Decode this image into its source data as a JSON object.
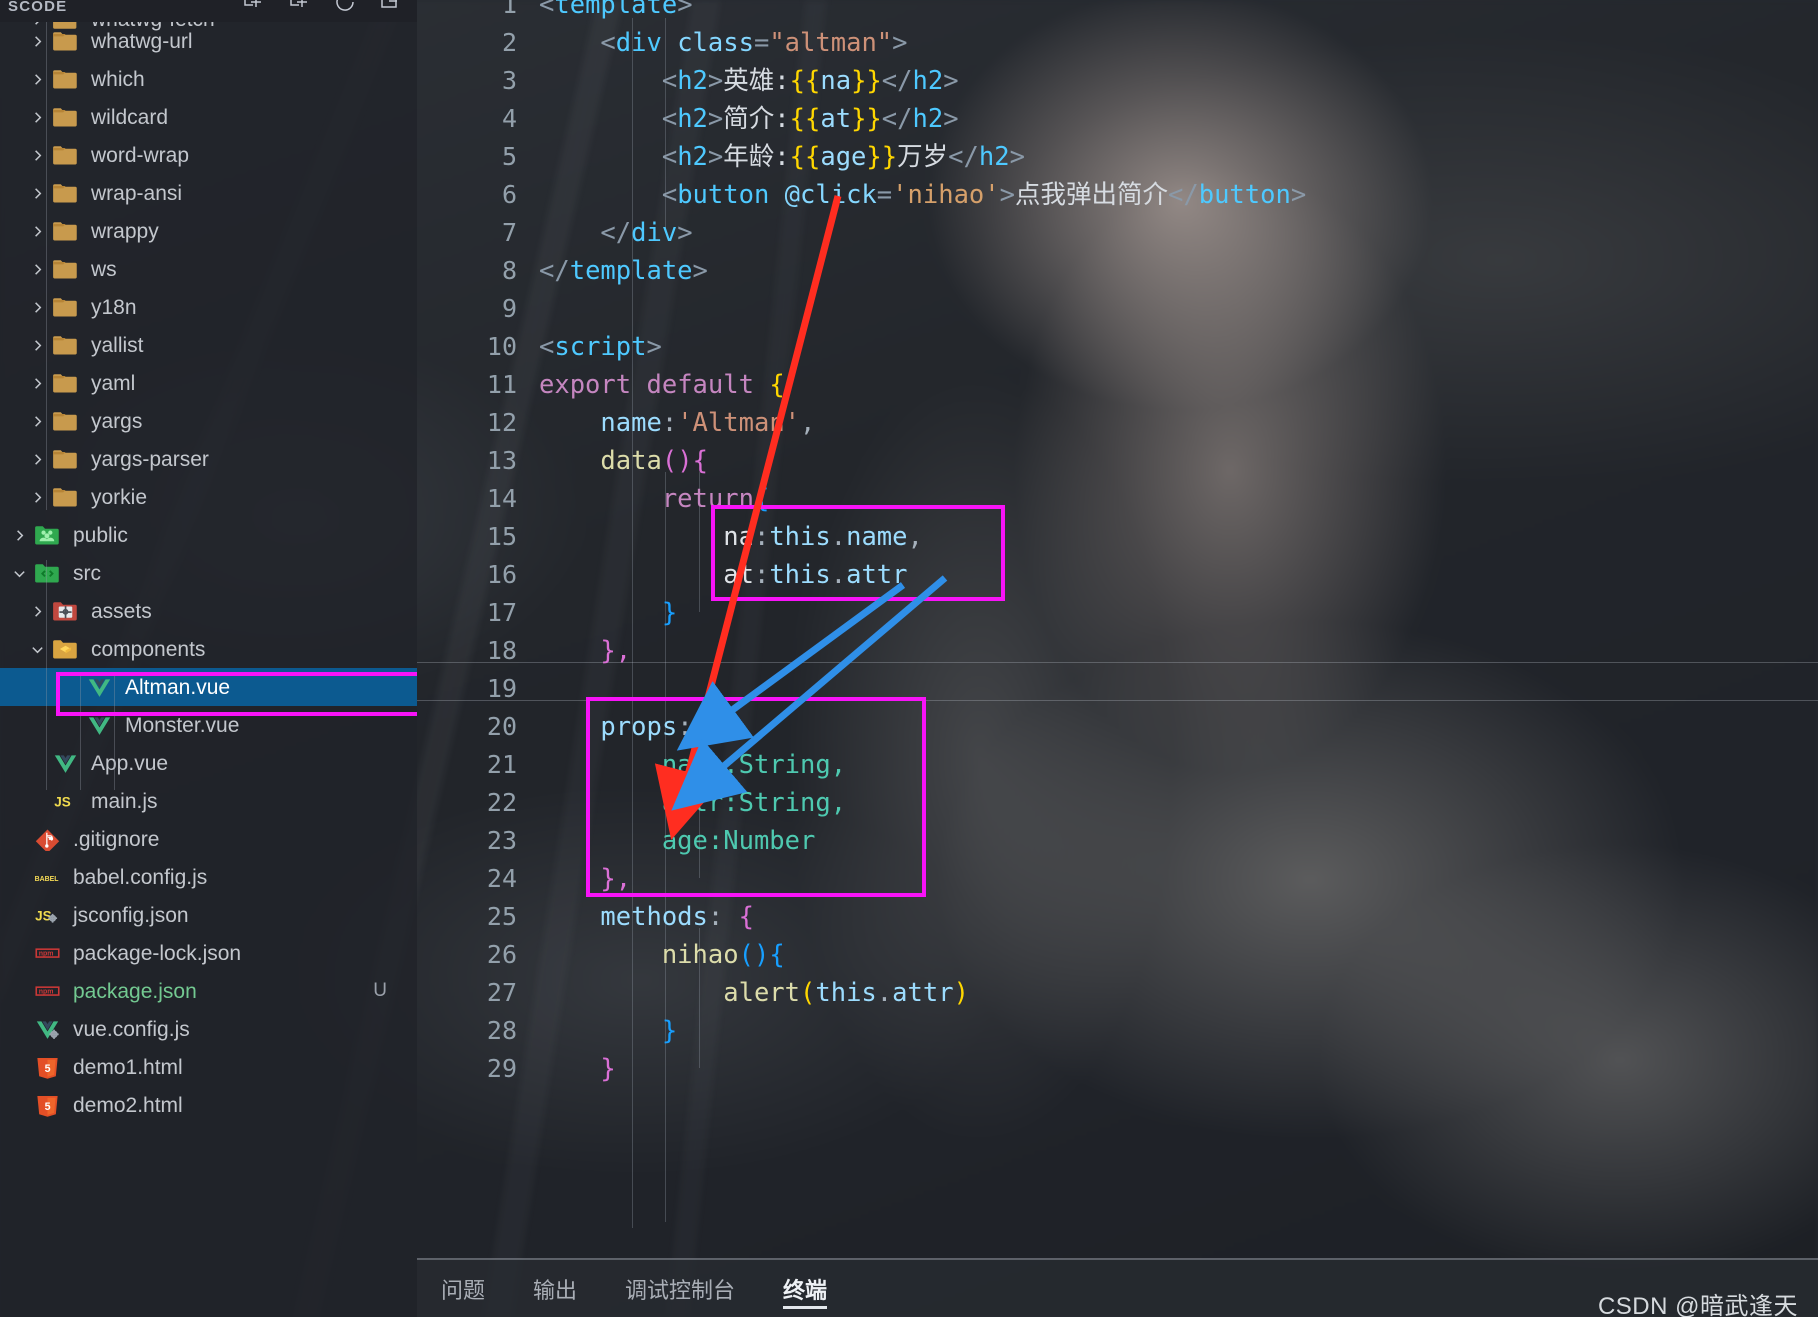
{
  "window": {
    "sidebar_title": "SCODE"
  },
  "sidebar": {
    "actions": [
      {
        "name": "new-file-icon",
        "label": "新建文件"
      },
      {
        "name": "new-folder-icon",
        "label": "新建文件夹"
      },
      {
        "name": "refresh-icon",
        "label": "刷新资源管理器"
      },
      {
        "name": "collapse-all-icon",
        "label": "在资源管理器中折叠文件夹"
      }
    ],
    "clipped_top_item": {
      "label": "whatwg-fetch",
      "icon": "folder-icon"
    },
    "items": [
      {
        "label": "whatwg-url",
        "icon": "folder-icon",
        "indent": 1,
        "expandable": true,
        "expanded": false
      },
      {
        "label": "which",
        "icon": "folder-icon",
        "indent": 1,
        "expandable": true,
        "expanded": false
      },
      {
        "label": "wildcard",
        "icon": "folder-icon",
        "indent": 1,
        "expandable": true,
        "expanded": false
      },
      {
        "label": "word-wrap",
        "icon": "folder-icon",
        "indent": 1,
        "expandable": true,
        "expanded": false
      },
      {
        "label": "wrap-ansi",
        "icon": "folder-icon",
        "indent": 1,
        "expandable": true,
        "expanded": false
      },
      {
        "label": "wrappy",
        "icon": "folder-icon",
        "indent": 1,
        "expandable": true,
        "expanded": false
      },
      {
        "label": "ws",
        "icon": "folder-icon",
        "indent": 1,
        "expandable": true,
        "expanded": false
      },
      {
        "label": "y18n",
        "icon": "folder-icon",
        "indent": 1,
        "expandable": true,
        "expanded": false
      },
      {
        "label": "yallist",
        "icon": "folder-icon",
        "indent": 1,
        "expandable": true,
        "expanded": false
      },
      {
        "label": "yaml",
        "icon": "folder-icon",
        "indent": 1,
        "expandable": true,
        "expanded": false
      },
      {
        "label": "yargs",
        "icon": "folder-icon",
        "indent": 1,
        "expandable": true,
        "expanded": false
      },
      {
        "label": "yargs-parser",
        "icon": "folder-icon",
        "indent": 1,
        "expandable": true,
        "expanded": false
      },
      {
        "label": "yorkie",
        "icon": "folder-icon",
        "indent": 1,
        "expandable": true,
        "expanded": false
      },
      {
        "label": "public",
        "icon": "public-folder-icon",
        "indent": 0,
        "expandable": true,
        "expanded": false
      },
      {
        "label": "src",
        "icon": "src-folder-icon",
        "indent": 0,
        "expandable": true,
        "expanded": true
      },
      {
        "label": "assets",
        "icon": "assets-folder-icon",
        "indent": 1,
        "expandable": true,
        "expanded": false
      },
      {
        "label": "components",
        "icon": "components-folder-icon",
        "indent": 1,
        "expandable": true,
        "expanded": true
      },
      {
        "label": "Altman.vue",
        "icon": "vue-file-icon",
        "indent": 2,
        "expandable": false,
        "selected": true,
        "highlighted": true
      },
      {
        "label": "Monster.vue",
        "icon": "vue-file-icon",
        "indent": 2,
        "expandable": false
      },
      {
        "label": "App.vue",
        "icon": "vue-file-icon",
        "indent": 1,
        "expandable": false
      },
      {
        "label": "main.js",
        "icon": "js-file-icon",
        "indent": 1,
        "expandable": false
      },
      {
        "label": ".gitignore",
        "icon": "git-file-icon",
        "indent": 0,
        "expandable": false
      },
      {
        "label": "babel.config.js",
        "icon": "babel-file-icon",
        "indent": 0,
        "expandable": false
      },
      {
        "label": "jsconfig.json",
        "icon": "jsconfig-file-icon",
        "indent": 0,
        "expandable": false
      },
      {
        "label": "package-lock.json",
        "icon": "npm-file-icon",
        "indent": 0,
        "expandable": false
      },
      {
        "label": "package.json",
        "icon": "npm-file-icon",
        "indent": 0,
        "expandable": false,
        "modified": true,
        "badge": "U"
      },
      {
        "label": "vue.config.js",
        "icon": "vue-config-file-icon",
        "indent": 0,
        "expandable": false
      },
      {
        "label": "demo1.html",
        "icon": "html5-file-icon",
        "indent": -1,
        "expandable": false
      },
      {
        "label": "demo2.html",
        "icon": "html5-file-icon",
        "indent": -1,
        "expandable": false
      }
    ]
  },
  "editor": {
    "language": "vue",
    "first_visible_line": 1,
    "last_visible_line": 29,
    "lines": [
      {
        "n": 1,
        "text": "<template>"
      },
      {
        "n": 2,
        "text": "    <div class=\"altman\">"
      },
      {
        "n": 3,
        "text": "        <h2>英雄:{{na}}</h2>"
      },
      {
        "n": 4,
        "text": "        <h2>简介:{{at}}</h2>"
      },
      {
        "n": 5,
        "text": "        <h2>年龄:{{age}}万岁</h2>"
      },
      {
        "n": 6,
        "text": "        <button @click='nihao'>点我弹出简介</button>"
      },
      {
        "n": 7,
        "text": "    </div>"
      },
      {
        "n": 8,
        "text": "</template>"
      },
      {
        "n": 9,
        "text": ""
      },
      {
        "n": 10,
        "text": "<script>"
      },
      {
        "n": 11,
        "text": "export default {"
      },
      {
        "n": 12,
        "text": "    name:'Altman',"
      },
      {
        "n": 13,
        "text": "    data(){"
      },
      {
        "n": 14,
        "text": "        return{"
      },
      {
        "n": 15,
        "text": "            na:this.name,"
      },
      {
        "n": 16,
        "text": "            at:this.attr"
      },
      {
        "n": 17,
        "text": "        }"
      },
      {
        "n": 18,
        "text": "    },"
      },
      {
        "n": 19,
        "text": ""
      },
      {
        "n": 20,
        "text": "    props:{"
      },
      {
        "n": 21,
        "text": "        name:String,"
      },
      {
        "n": 22,
        "text": "        attr:String,"
      },
      {
        "n": 23,
        "text": "        age:Number"
      },
      {
        "n": 24,
        "text": "    },"
      },
      {
        "n": 25,
        "text": "    methods: {"
      },
      {
        "n": 26,
        "text": "        nihao(){"
      },
      {
        "n": 27,
        "text": "            alert(this.attr)"
      },
      {
        "n": 28,
        "text": "        }"
      },
      {
        "n": 29,
        "text": "    }"
      }
    ]
  },
  "annotations": {
    "box_color": "#f813f8",
    "arrow_red_color": "#ff2d20",
    "arrow_blue_color": "#2f8fe8",
    "boxes": [
      {
        "name": "data-return-box",
        "covers_lines": "15-16"
      },
      {
        "name": "props-box",
        "covers_lines": "20-24"
      },
      {
        "name": "altman-vue-file-box",
        "covers": "Altman.vue"
      }
    ],
    "arrows": [
      {
        "name": "red-arrow",
        "from": "line 6 button",
        "to": "line 22 attr:String"
      },
      {
        "name": "blue-arrow-1",
        "from": "line 15 na:this.name",
        "to": "line 21 name:String"
      },
      {
        "name": "blue-arrow-2",
        "from": "line 16 at:this.attr",
        "to": "line 22 attr:String"
      }
    ]
  },
  "panel": {
    "tabs": [
      {
        "label": "问题",
        "active": false
      },
      {
        "label": "输出",
        "active": false
      },
      {
        "label": "调试控制台",
        "active": false
      },
      {
        "label": "终端",
        "active": true
      }
    ]
  },
  "watermark": {
    "text": "CSDN @暗武逢天"
  }
}
